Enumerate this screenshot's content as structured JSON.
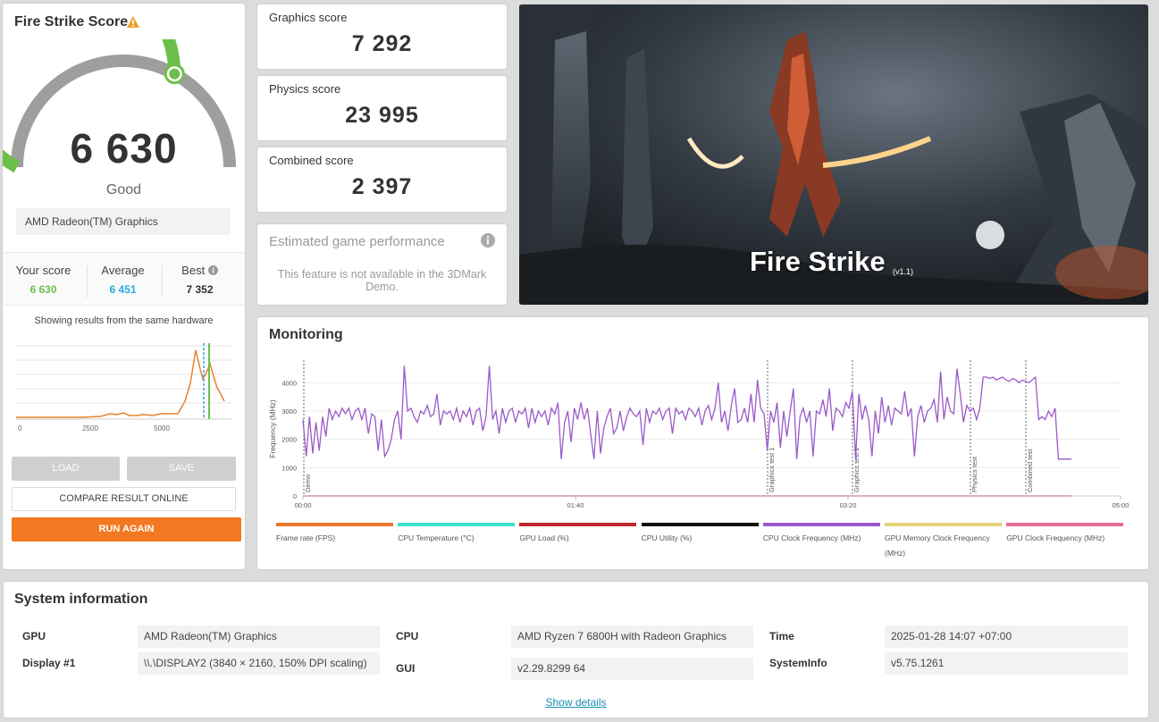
{
  "score_panel": {
    "title": "Fire Strike Score",
    "score": "6 630",
    "rating": "Good",
    "gpu_name": "AMD Radeon(TM) Graphics",
    "your_score_label": "Your score",
    "your_score": "6 630",
    "average_label": "Average",
    "average": "6 451",
    "best_label": "Best",
    "best": "7 352",
    "same_hardware_note": "Showing results from the same hardware",
    "distribution_ticks": [
      "0",
      "2500",
      "5000"
    ],
    "load_label": "LOAD",
    "save_label": "SAVE",
    "compare_label": "COMPARE RESULT ONLINE",
    "run_again_label": "RUN AGAIN",
    "gauge_fraction": 0.66
  },
  "scores": {
    "graphics_label": "Graphics score",
    "graphics": "7 292",
    "physics_label": "Physics score",
    "physics": "23 995",
    "combined_label": "Combined score",
    "combined": "2 397"
  },
  "estimated": {
    "title": "Estimated game performance",
    "message": "This feature is not available in the 3DMark Demo."
  },
  "hero": {
    "title": "Fire Strike",
    "version": "(v1.1)"
  },
  "monitoring": {
    "title": "Monitoring",
    "y_axis_label": "Frequency (MHz)",
    "y_ticks": [
      "0",
      "1000",
      "2000",
      "3000",
      "4000"
    ],
    "x_ticks": [
      "00:00",
      "01:40",
      "03:20",
      "05:00"
    ],
    "markers": [
      "Demo",
      "Graphics test 1",
      "Graphics test 2",
      "Physics test",
      "Combined test"
    ],
    "legend": [
      {
        "label": "Frame rate (FPS)",
        "color": "#e8762b"
      },
      {
        "label": "CPU Temperature (°C)",
        "color": "#3ee0cf"
      },
      {
        "label": "GPU Load (%)",
        "color": "#c0282d"
      },
      {
        "label": "CPU Utility (%)",
        "color": "#111111"
      },
      {
        "label": "CPU Clock Frequency (MHz)",
        "color": "#9b59c9"
      },
      {
        "label": "GPU Memory Clock Frequency (MHz)",
        "color": "#e3d27c"
      },
      {
        "label": "GPU Clock Frequency (MHz)",
        "color": "#e96c96"
      }
    ]
  },
  "chart_data": {
    "type": "line",
    "ylabel": "Frequency (MHz)",
    "xlabel": "",
    "ylim": [
      0,
      4800
    ],
    "xlim": [
      "00:00",
      "05:00"
    ],
    "series": [
      {
        "name": "CPU Clock Frequency (MHz)",
        "color": "#9b59c9",
        "values": [
          2700,
          1400,
          2800,
          1500,
          2600,
          1600,
          2800,
          2100,
          3100,
          2700,
          3000,
          2800,
          3100,
          2900,
          3100,
          2700,
          3000,
          3100,
          2700,
          3100,
          2200,
          2900,
          2800,
          1600,
          2700,
          1400,
          1600,
          2000,
          2700,
          3000,
          2000,
          4600,
          3000,
          3100,
          2800,
          2600,
          3000,
          2900,
          3200,
          2800,
          2900,
          3600,
          2500,
          3000,
          2900,
          3000,
          2700,
          3100,
          2600,
          3000,
          2800,
          3100,
          2500,
          3000,
          3100,
          2300,
          2800,
          4600,
          2700,
          3000,
          2200,
          3100,
          2600,
          3000,
          3100,
          2600,
          3000,
          2900,
          3100,
          2400,
          3100,
          2600,
          3000,
          2800,
          3000,
          2500,
          3100,
          2900,
          3300,
          1300,
          2600,
          3000,
          1900,
          3100,
          2700,
          3300,
          2700,
          3100,
          2200,
          1300,
          3000,
          1500,
          2400,
          2800,
          3100,
          2200,
          2400,
          3000,
          2300,
          2800,
          3100,
          2900,
          2800,
          3000,
          1800,
          3100,
          2600,
          3000,
          2900,
          3100,
          2700,
          3000,
          3100,
          2200,
          3100,
          2900,
          3000,
          2700,
          3100,
          3000,
          2800,
          3100,
          2500,
          3000,
          3200,
          2700,
          3100,
          4000,
          2600,
          3000,
          2300,
          3200,
          3800,
          2600,
          2700,
          3100,
          2600,
          3600,
          2600,
          4100,
          3100,
          2900,
          1600,
          3000,
          2600,
          3300,
          1700,
          3000,
          2100,
          3000,
          3800,
          1300,
          2800,
          3100,
          2600,
          3000,
          1400,
          3000,
          2900,
          3400,
          2800,
          3800,
          2300,
          3100,
          3000,
          2800,
          3300,
          3100,
          3700,
          1300,
          3600,
          2700,
          3200,
          2700,
          1400,
          3000,
          2200,
          3500,
          2600,
          3200,
          2500,
          3100,
          3000,
          2900,
          3700,
          2800,
          3100,
          1400,
          2800,
          3200,
          2600,
          3000,
          3100,
          3400,
          2600,
          4400,
          2700,
          3500,
          3000,
          2900,
          4500,
          3600,
          2600,
          3200,
          3000,
          3100,
          2700,
          3100,
          4200,
          4200,
          4150,
          4200,
          4100,
          4150,
          4200,
          4100,
          4050,
          4150,
          4100,
          4000,
          4100,
          4050,
          4000,
          4100,
          4200,
          2700,
          2800,
          2700,
          3000,
          2800,
          3100,
          1300,
          1300,
          1300,
          1300,
          1300
        ]
      },
      {
        "name": "GPU Clock Frequency (MHz)",
        "color": "#e96c96",
        "values": [
          0,
          0
        ]
      }
    ]
  },
  "system_info": {
    "title": "System information",
    "gpu_label": "GPU",
    "gpu": "AMD Radeon(TM) Graphics",
    "display_label": "Display #1",
    "display": "\\\\.\\DISPLAY2 (3840 × 2160, 150% DPI scaling)",
    "cpu_label": "CPU",
    "cpu": "AMD Ryzen 7 6800H with Radeon Graphics",
    "gui_label": "GUI",
    "gui": "v2.29.8299 64",
    "time_label": "Time",
    "time": "2025-01-28 14:07 +07:00",
    "systeminfo_label": "SystemInfo",
    "systeminfo": "v5.75.1261",
    "show_details": "Show details"
  },
  "colors": {
    "accent_orange": "#f47721",
    "gauge_green": "#6cc04a",
    "average_blue": "#2ca8e0"
  }
}
